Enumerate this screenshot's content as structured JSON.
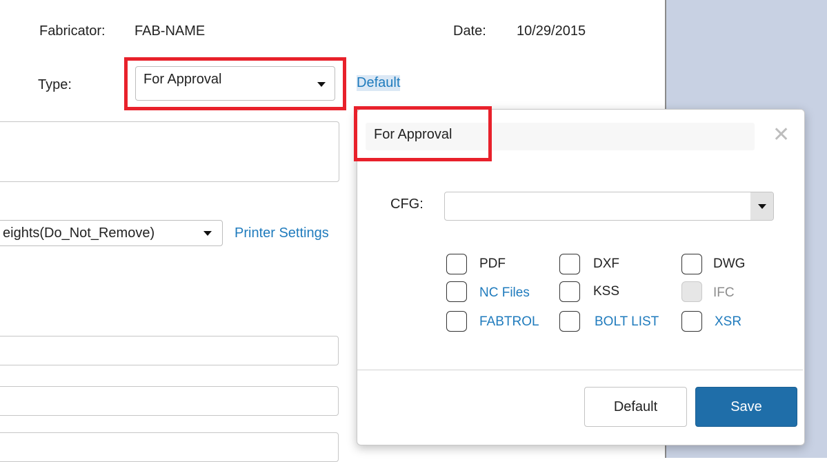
{
  "header": {
    "fabricator_label": "Fabricator:",
    "fabricator_value": "FAB-NAME",
    "date_label": "Date:",
    "date_value": "10/29/2015"
  },
  "type_row": {
    "label": "Type:",
    "selected": "For Approval",
    "default_link": "Default"
  },
  "template_row": {
    "selected": "eights(Do_Not_Remove)",
    "printer_settings_link": "Printer Settings"
  },
  "modal": {
    "title": "For Approval",
    "close_icon": "close-icon",
    "cfg_label": "CFG:",
    "cfg_value": "",
    "checkboxes": [
      {
        "label": "PDF",
        "checked": false,
        "style": "plain"
      },
      {
        "label": "DXF",
        "checked": false,
        "style": "plain"
      },
      {
        "label": "DWG",
        "checked": false,
        "style": "plain"
      },
      {
        "label": "NC Files",
        "checked": false,
        "style": "link"
      },
      {
        "label": "KSS",
        "checked": false,
        "style": "plain"
      },
      {
        "label": "IFC",
        "checked": false,
        "style": "disabled"
      },
      {
        "label": "FABTROL",
        "checked": false,
        "style": "link"
      },
      {
        "label": "BOLT LIST",
        "checked": false,
        "style": "link"
      },
      {
        "label": "XSR",
        "checked": false,
        "style": "link"
      }
    ],
    "default_button": "Default",
    "save_button": "Save"
  },
  "colors": {
    "accent_link": "#1f7bbd",
    "save_button_bg": "#1f6ea9",
    "highlight_red": "#e8212b",
    "right_panel": "#c8d1e3"
  }
}
